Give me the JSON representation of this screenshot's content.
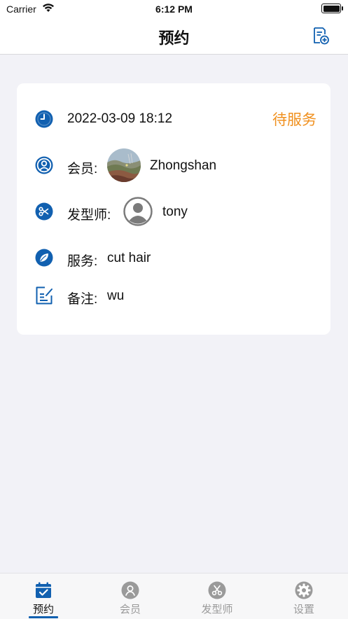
{
  "status_bar": {
    "carrier": "Carrier",
    "time": "6:12 PM"
  },
  "nav": {
    "title": "预约",
    "add_icon": "add-document-icon"
  },
  "appointment": {
    "datetime": "2022-03-09 18:12",
    "status": "待服务",
    "member_label": "会员:",
    "member_name": "Zhongshan",
    "stylist_label": "发型师:",
    "stylist_name": "tony",
    "service_label": "服务:",
    "service_value": "cut hair",
    "note_label": "备注:",
    "note_value": "wu"
  },
  "tabs": [
    {
      "label": "预约",
      "icon": "calendar-check-icon",
      "active": true
    },
    {
      "label": "会员",
      "icon": "member-icon",
      "active": false
    },
    {
      "label": "发型师",
      "icon": "scissors-icon",
      "active": false
    },
    {
      "label": "设置",
      "icon": "gear-icon",
      "active": false
    }
  ],
  "colors": {
    "accent": "#1160b0",
    "status": "#f0901e",
    "background": "#f2f2f7",
    "inactive": "#9a9a9a"
  }
}
